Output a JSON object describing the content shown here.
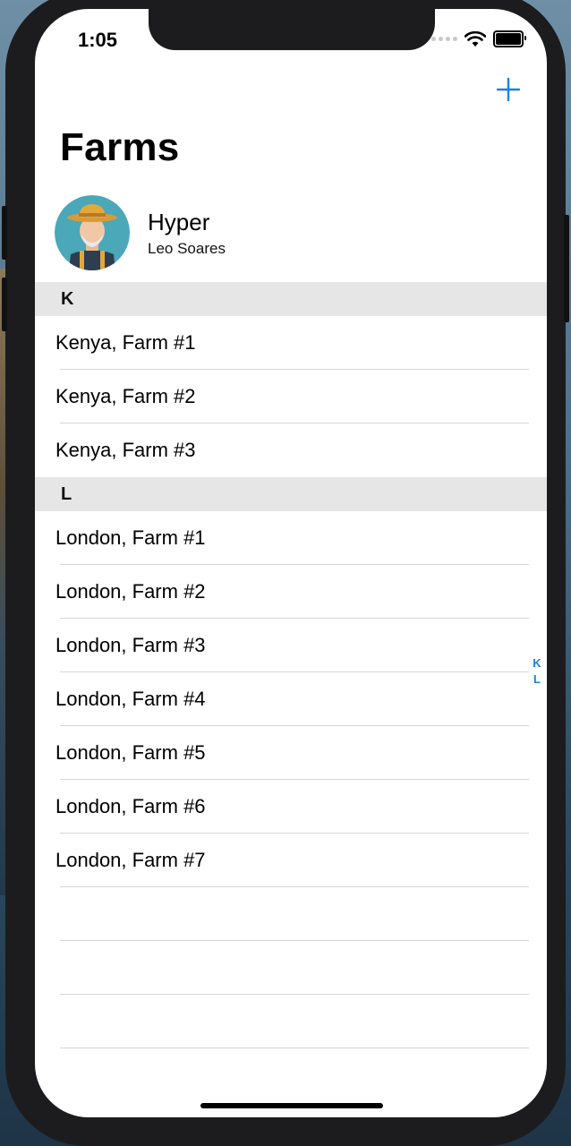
{
  "status": {
    "time": "1:05"
  },
  "nav": {
    "add_icon": "plus-icon",
    "title": "Farms"
  },
  "profile": {
    "name": "Hyper",
    "subtitle": "Leo Soares",
    "avatar_icon": "farmer-avatar"
  },
  "sections": [
    {
      "header": "K",
      "rows": [
        "Kenya, Farm #1",
        "Kenya, Farm #2",
        "Kenya, Farm #3"
      ]
    },
    {
      "header": "L",
      "rows": [
        "London, Farm #1",
        "London, Farm #2",
        "London, Farm #3",
        "London, Farm #4",
        "London, Farm #5",
        "London, Farm #6",
        "London, Farm #7"
      ]
    }
  ],
  "index": [
    "K",
    "L"
  ],
  "colors": {
    "accent": "#1a82e2",
    "section_bg": "#e6e6e6",
    "separator": "#d6d6d6"
  }
}
